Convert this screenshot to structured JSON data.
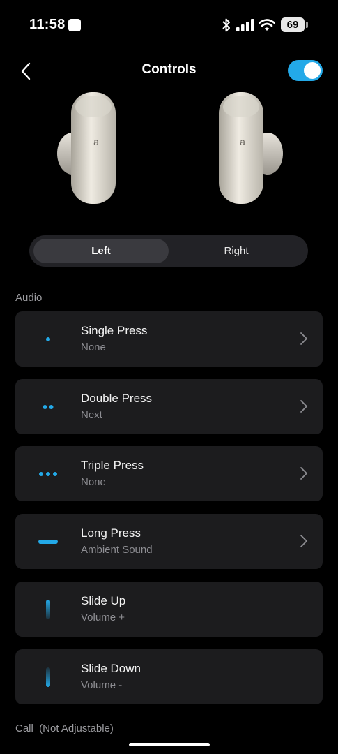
{
  "status_bar": {
    "time": "11:58",
    "battery": "69"
  },
  "header": {
    "title": "Controls",
    "toggle_on": true
  },
  "tabs": {
    "left": "Left",
    "right": "Right",
    "selected": "Left"
  },
  "audio_section": {
    "label": "Audio",
    "items": [
      {
        "title": "Single Press",
        "value": "None",
        "icon": "single-dot-icon",
        "adjustable": true
      },
      {
        "title": "Double Press",
        "value": "Next",
        "icon": "double-dot-icon",
        "adjustable": true
      },
      {
        "title": "Triple Press",
        "value": "None",
        "icon": "triple-dot-icon",
        "adjustable": true
      },
      {
        "title": "Long Press",
        "value": "Ambient Sound",
        "icon": "long-press-icon",
        "adjustable": true
      },
      {
        "title": "Slide Up",
        "value": "Volume +",
        "icon": "slide-up-icon",
        "adjustable": false
      },
      {
        "title": "Slide Down",
        "value": "Volume -",
        "icon": "slide-down-icon",
        "adjustable": false
      }
    ]
  },
  "call_section": {
    "label": "Call  (Not Adjustable)"
  },
  "colors": {
    "accent": "#23a9e8",
    "card": "#1c1c1e",
    "background": "#000000"
  }
}
